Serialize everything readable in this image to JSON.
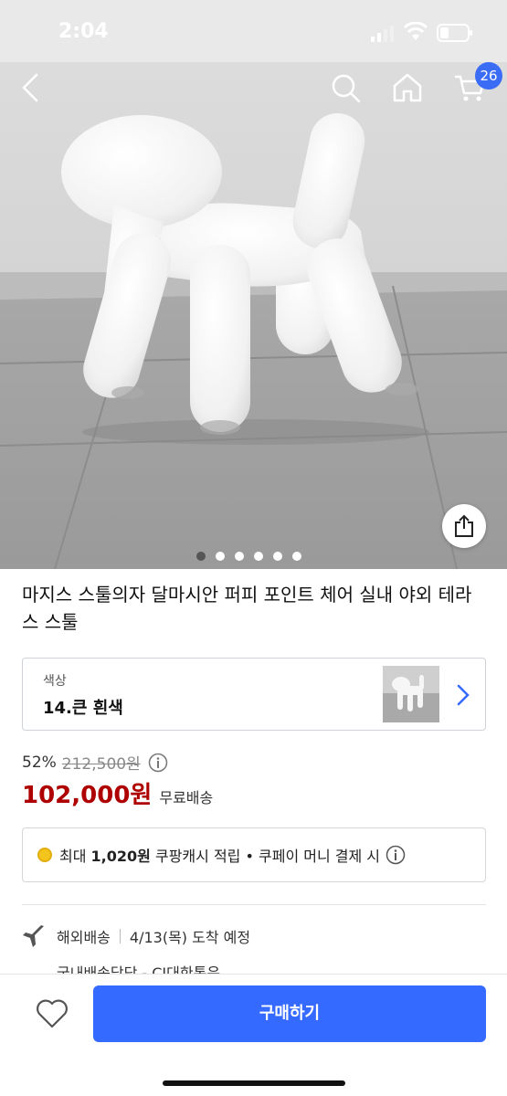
{
  "status": {
    "time": "2:04"
  },
  "nav": {
    "cart_count": "26"
  },
  "gallery": {
    "slide_count": 6,
    "active_index": 0
  },
  "product": {
    "title": "마지스 스툴의자 달마시안 퍼피 포인트 체어 실내 야외 테라스 스툴"
  },
  "option": {
    "label": "색상",
    "value": "14.큰 흰색"
  },
  "price": {
    "discount": "52%",
    "original": "212,500원",
    "sale": "102,000원",
    "shipping": "무료배송"
  },
  "cash": {
    "prefix": "최대",
    "amount": "1,020원",
    "suffix": "쿠팡캐시 적립 • 쿠페이 머니 결제 시"
  },
  "delivery": {
    "type": "해외배송",
    "eta": "4/13(목) 도착 예정",
    "note": "국내배송담당 - CJ대한통운"
  },
  "bottom": {
    "buy_label": "구매하기"
  },
  "colors": {
    "accent": "#346aff",
    "price": "#ae0000",
    "badge": "#3b6cf5"
  }
}
